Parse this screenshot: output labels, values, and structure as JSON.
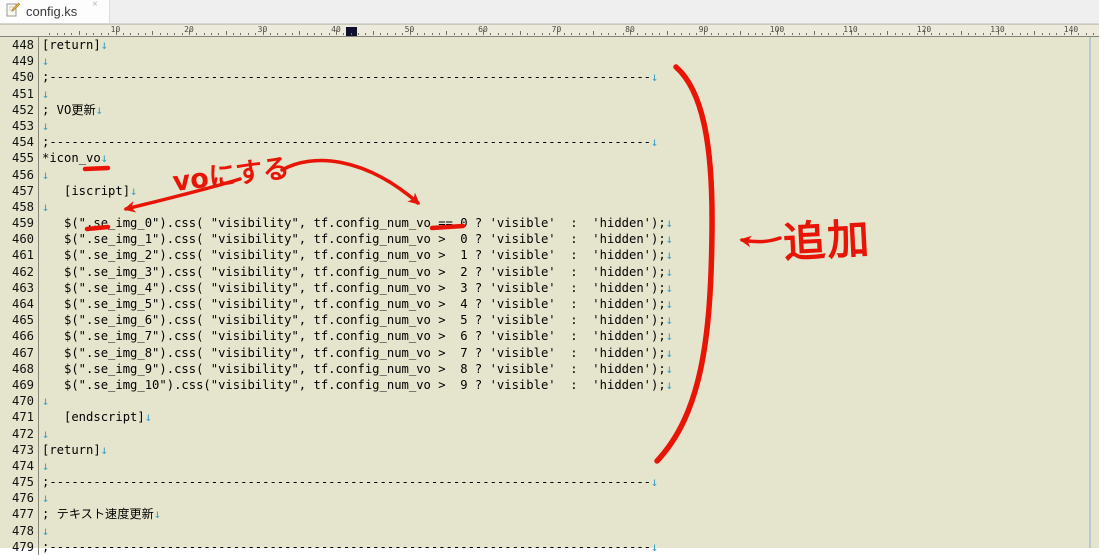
{
  "tab": {
    "title": "config.ks",
    "close_label": "×"
  },
  "ruler": {
    "unit_labels": [
      "10",
      "20",
      "30",
      "40",
      "50",
      "60",
      "70",
      "80",
      "90",
      "100",
      "110",
      "120",
      "130",
      "140"
    ],
    "cursor_col": 42
  },
  "colors": {
    "editor_bg": "#e5e4cd",
    "annotation_red": "#e81507",
    "eol_arrow_blue": "#3b9fc6",
    "margin_line_blue": "#b2ccd6"
  },
  "editor": {
    "eol_mark": "↓",
    "lines": [
      {
        "num": "448",
        "text": "[return]"
      },
      {
        "num": "449",
        "text": ""
      },
      {
        "num": "450",
        "text": ";----------------------------------------------------------------------------------"
      },
      {
        "num": "451",
        "text": ""
      },
      {
        "num": "452",
        "text": "; VO更新"
      },
      {
        "num": "453",
        "text": ""
      },
      {
        "num": "454",
        "text": ";----------------------------------------------------------------------------------"
      },
      {
        "num": "455",
        "text": "*icon_vo"
      },
      {
        "num": "456",
        "text": ""
      },
      {
        "num": "457",
        "text": "   [iscript]"
      },
      {
        "num": "458",
        "text": ""
      },
      {
        "num": "459",
        "text": "   $(\".se_img_0\").css( \"visibility\", tf.config_num_vo == 0 ? 'visible'  :  'hidden');"
      },
      {
        "num": "460",
        "text": "   $(\".se_img_1\").css( \"visibility\", tf.config_num_vo >  0 ? 'visible'  :  'hidden');"
      },
      {
        "num": "461",
        "text": "   $(\".se_img_2\").css( \"visibility\", tf.config_num_vo >  1 ? 'visible'  :  'hidden');"
      },
      {
        "num": "462",
        "text": "   $(\".se_img_3\").css( \"visibility\", tf.config_num_vo >  2 ? 'visible'  :  'hidden');"
      },
      {
        "num": "463",
        "text": "   $(\".se_img_4\").css( \"visibility\", tf.config_num_vo >  3 ? 'visible'  :  'hidden');"
      },
      {
        "num": "464",
        "text": "   $(\".se_img_5\").css( \"visibility\", tf.config_num_vo >  4 ? 'visible'  :  'hidden');"
      },
      {
        "num": "465",
        "text": "   $(\".se_img_6\").css( \"visibility\", tf.config_num_vo >  5 ? 'visible'  :  'hidden');"
      },
      {
        "num": "466",
        "text": "   $(\".se_img_7\").css( \"visibility\", tf.config_num_vo >  6 ? 'visible'  :  'hidden');"
      },
      {
        "num": "467",
        "text": "   $(\".se_img_8\").css( \"visibility\", tf.config_num_vo >  7 ? 'visible'  :  'hidden');"
      },
      {
        "num": "468",
        "text": "   $(\".se_img_9\").css( \"visibility\", tf.config_num_vo >  8 ? 'visible'  :  'hidden');"
      },
      {
        "num": "469",
        "text": "   $(\".se_img_10\").css(\"visibility\", tf.config_num_vo >  9 ? 'visible'  :  'hidden');"
      },
      {
        "num": "470",
        "text": ""
      },
      {
        "num": "471",
        "text": "   [endscript]"
      },
      {
        "num": "472",
        "text": ""
      },
      {
        "num": "473",
        "text": "[return]"
      },
      {
        "num": "474",
        "text": ""
      },
      {
        "num": "475",
        "text": ";----------------------------------------------------------------------------------"
      },
      {
        "num": "476",
        "text": ""
      },
      {
        "num": "477",
        "text": "; テキスト速度更新"
      },
      {
        "num": "478",
        "text": ""
      },
      {
        "num": "479",
        "text": ";----------------------------------------------------------------------------------"
      }
    ]
  },
  "annotations": {
    "note_vo": "voにする",
    "note_tsuika": "追加"
  }
}
